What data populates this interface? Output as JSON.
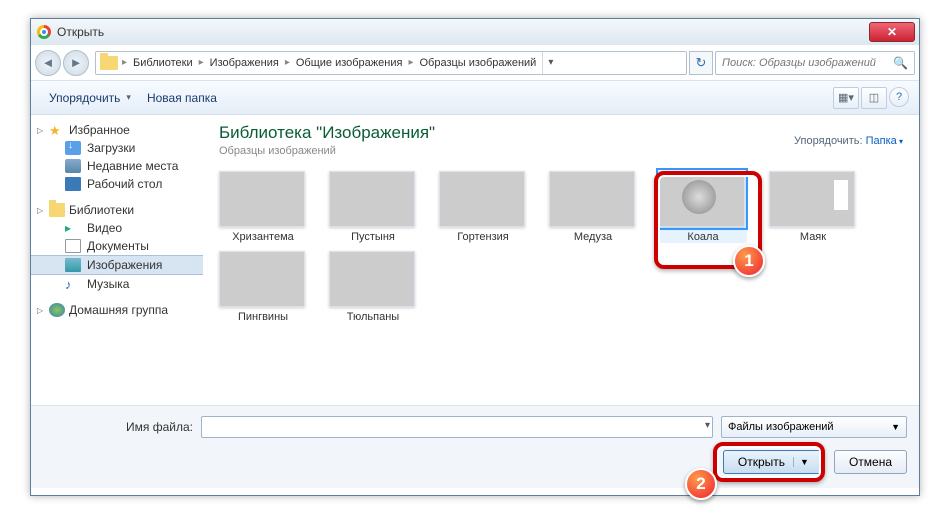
{
  "title": "Открыть",
  "breadcrumb": [
    "Библиотеки",
    "Изображения",
    "Общие изображения",
    "Образцы изображений"
  ],
  "search_placeholder": "Поиск: Образцы изображений",
  "toolbar": {
    "organize": "Упорядочить",
    "new_folder": "Новая папка"
  },
  "sidebar": {
    "favorites": {
      "label": "Избранное",
      "items": [
        "Загрузки",
        "Недавние места",
        "Рабочий стол"
      ]
    },
    "libraries": {
      "label": "Библиотеки",
      "items": [
        "Видео",
        "Документы",
        "Изображения",
        "Музыка"
      ],
      "selected": 2
    },
    "homegroup": "Домашняя группа"
  },
  "content": {
    "lib_title": "Библиотека \"Изображения\"",
    "lib_sub": "Образцы изображений",
    "sort_label": "Упорядочить:",
    "sort_value": "Папка",
    "thumbs": [
      "Хризантема",
      "Пустыня",
      "Гортензия",
      "Медуза",
      "Коала",
      "Маяк",
      "Пингвины",
      "Тюльпаны"
    ],
    "selected_index": 4
  },
  "footer": {
    "file_label": "Имя файла:",
    "file_value": "",
    "filter": "Файлы изображений",
    "open": "Открыть",
    "cancel": "Отмена"
  },
  "annotations": {
    "badge1": "1",
    "badge2": "2"
  }
}
